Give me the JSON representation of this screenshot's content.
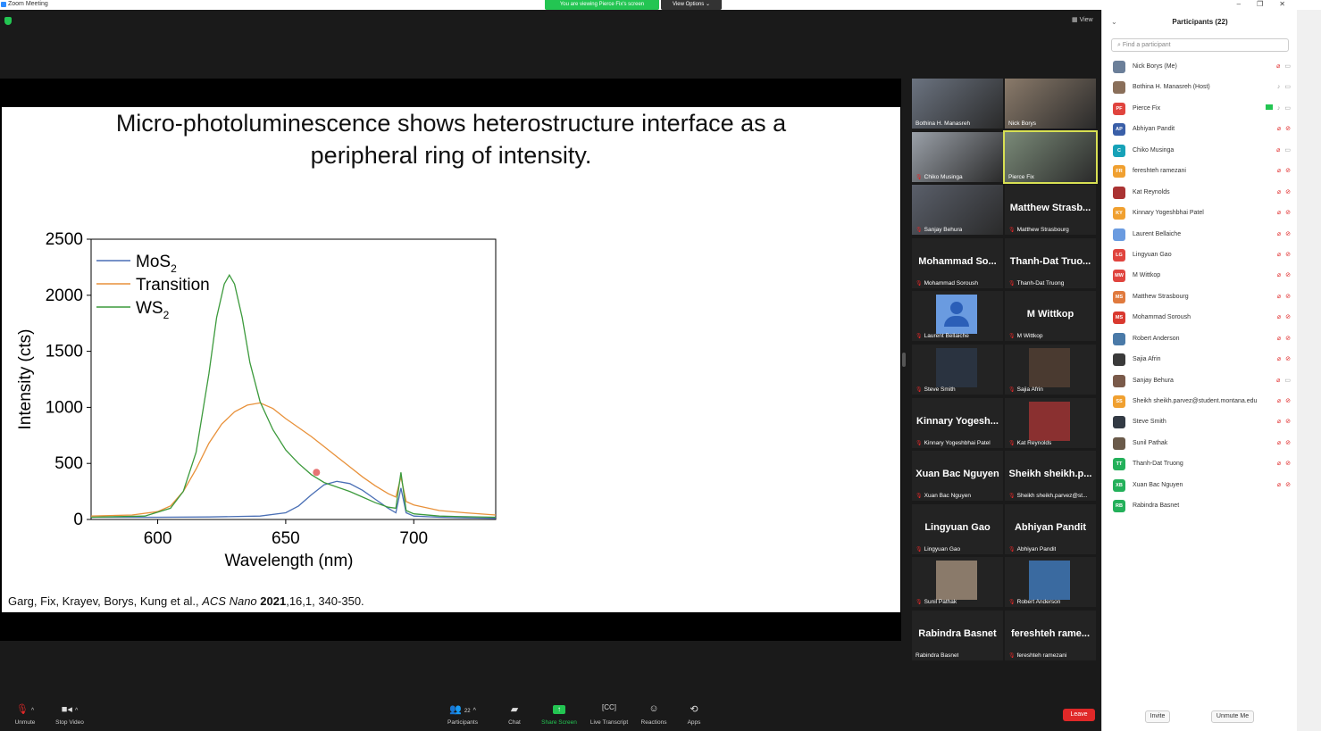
{
  "window": {
    "title": "Zoom Meeting"
  },
  "banner": {
    "viewing": "You are viewing Pierce Fix's screen",
    "view_options": "View Options ⌄"
  },
  "view_button": "View",
  "slide": {
    "title_line1": "Micro-photoluminescence shows heterostructure interface as a",
    "title_line2": "peripheral ring of intensity.",
    "citation_authors": "Garg, Fix, Krayev, Borys, Kung et al., ",
    "citation_journal": "ACS Nano",
    "citation_year": "2021",
    "citation_rest": ",16,1, 340-350."
  },
  "chart_data": {
    "type": "line",
    "xlabel": "Wavelength (nm)",
    "ylabel": "Intensity (cts)",
    "xlim": [
      574,
      732
    ],
    "ylim": [
      0,
      2500
    ],
    "xticks": [
      600,
      650,
      700
    ],
    "yticks": [
      0,
      500,
      1000,
      1500,
      2000,
      2500
    ],
    "legend_position": "top-left",
    "legend": [
      {
        "label": "MoS",
        "sub": "2",
        "color": "#4a6fb5"
      },
      {
        "label": "Transition",
        "sub": "",
        "color": "#e8913a"
      },
      {
        "label": "WS",
        "sub": "2",
        "color": "#3c9a3c"
      }
    ],
    "series": [
      {
        "name": "MoS2",
        "color": "#4a6fb5",
        "x": [
          574,
          600,
          620,
          640,
          650,
          655,
          660,
          665,
          670,
          675,
          680,
          685,
          690,
          693,
          695,
          697,
          700,
          710,
          720,
          732
        ],
        "y": [
          20,
          20,
          22,
          30,
          60,
          120,
          220,
          310,
          340,
          320,
          260,
          180,
          100,
          60,
          280,
          60,
          30,
          20,
          15,
          10
        ]
      },
      {
        "name": "Transition",
        "color": "#e8913a",
        "x": [
          574,
          590,
          600,
          605,
          610,
          615,
          620,
          625,
          630,
          635,
          640,
          645,
          650,
          655,
          660,
          665,
          670,
          675,
          680,
          685,
          690,
          693,
          695,
          697,
          700,
          710,
          720,
          732
        ],
        "y": [
          30,
          40,
          70,
          120,
          250,
          450,
          680,
          850,
          960,
          1020,
          1040,
          990,
          900,
          820,
          740,
          650,
          560,
          470,
          380,
          300,
          230,
          200,
          380,
          160,
          130,
          80,
          60,
          40
        ]
      },
      {
        "name": "WS2",
        "color": "#3c9a3c",
        "x": [
          574,
          595,
          605,
          610,
          615,
          620,
          623,
          626,
          628,
          630,
          633,
          636,
          640,
          645,
          650,
          655,
          660,
          665,
          670,
          675,
          680,
          685,
          690,
          693,
          695,
          697,
          700,
          710,
          720,
          732
        ],
        "y": [
          20,
          30,
          100,
          250,
          600,
          1300,
          1800,
          2100,
          2180,
          2100,
          1800,
          1400,
          1050,
          800,
          620,
          500,
          400,
          330,
          290,
          250,
          200,
          150,
          110,
          100,
          420,
          80,
          50,
          30,
          25,
          20
        ]
      }
    ]
  },
  "gallery": [
    {
      "name": "Bothina H. Manasreh",
      "big": "",
      "video": "room",
      "muted": false
    },
    {
      "name": "Nick Borys",
      "big": "",
      "video": "person",
      "muted": false
    },
    {
      "name": "Chiko Musinga",
      "big": "",
      "video": "window",
      "muted": true
    },
    {
      "name": "Pierce Fix",
      "big": "",
      "video": "person2",
      "muted": false,
      "active": true
    },
    {
      "name": "Sanjay Behura",
      "big": "",
      "video": "person3",
      "muted": true
    },
    {
      "name": "Matthew Strasbourg",
      "big": "Matthew  Strasb...",
      "video": "",
      "muted": true
    },
    {
      "name": "Mohammad Soroush",
      "big": "Mohammad  So...",
      "video": "",
      "muted": true
    },
    {
      "name": "Thanh-Dat Truong",
      "big": "Thanh-Dat  Truo...",
      "video": "",
      "muted": true
    },
    {
      "name": "Laurent Bellaiche",
      "big": "",
      "video": "avatar-blue",
      "muted": true
    },
    {
      "name": "M Wittkop",
      "big": "M Wittkop",
      "video": "",
      "muted": true
    },
    {
      "name": "Steve Smith",
      "big": "",
      "video": "pic-dark",
      "muted": true
    },
    {
      "name": "Sajia Afrin",
      "big": "",
      "video": "pic-face",
      "muted": true
    },
    {
      "name": "Kinnary Yogeshbhai Patel",
      "big": "Kinnary  Yogesh...",
      "video": "",
      "muted": true
    },
    {
      "name": "Kat Reynolds",
      "big": "",
      "video": "pic-red",
      "muted": true
    },
    {
      "name": "Xuan Bac Nguyen",
      "big": "Xuan Bac Nguyen",
      "video": "",
      "muted": true
    },
    {
      "name": "Sheikh sheikh.parvez@st...",
      "big": "Sheikh  sheikh.p...",
      "video": "",
      "muted": true
    },
    {
      "name": "Lingyuan Gao",
      "big": "Lingyuan Gao",
      "video": "",
      "muted": true
    },
    {
      "name": "Abhiyan Pandit",
      "big": "Abhiyan Pandit",
      "video": "",
      "muted": true
    },
    {
      "name": "Sunil Pathak",
      "big": "",
      "video": "pic-man",
      "muted": true
    },
    {
      "name": "Robert Anderson",
      "big": "",
      "video": "pic-statue",
      "muted": true
    },
    {
      "name": "Rabindra Basnet",
      "big": "Rabindra Basnet",
      "video": "",
      "muted": false
    },
    {
      "name": "fereshteh ramezani",
      "big": "fereshteh  rame...",
      "video": "",
      "muted": true
    }
  ],
  "toolbar": {
    "unmute": "Unmute",
    "stop_video": "Stop Video",
    "participants": "Participants",
    "participants_count": "22",
    "chat": "Chat",
    "share_screen": "Share Screen",
    "live_transcript": "Live Transcript",
    "reactions": "Reactions",
    "apps": "Apps",
    "leave": "Leave"
  },
  "panel": {
    "header": "Participants (22)",
    "search_placeholder": "Find a participant",
    "invite": "Invite",
    "unmute_me": "Unmute Me",
    "participants": [
      {
        "name": "Nick Borys (Me)",
        "initials": "",
        "color": "#6b7f99",
        "muted": true,
        "video_off": false
      },
      {
        "name": "Bothina H. Manasreh (Host)",
        "initials": "",
        "color": "#8a6f5a",
        "muted": false,
        "video_off": false
      },
      {
        "name": "Pierce Fix",
        "initials": "PF",
        "color": "#e0443e",
        "muted": false,
        "video_off": false,
        "sharing": true
      },
      {
        "name": "Abhiyan Pandit",
        "initials": "AP",
        "color": "#3a5fa8",
        "muted": true,
        "video_off": true
      },
      {
        "name": "Chiko Musinga",
        "initials": "C",
        "color": "#17a2b8",
        "muted": true,
        "video_off": false
      },
      {
        "name": "fereshteh ramezani",
        "initials": "FR",
        "color": "#f0a030",
        "muted": true,
        "video_off": true
      },
      {
        "name": "Kat Reynolds",
        "initials": "",
        "color": "#a33",
        "muted": true,
        "video_off": true
      },
      {
        "name": "Kinnary Yogeshbhai Patel",
        "initials": "KY",
        "color": "#f0a030",
        "muted": true,
        "video_off": true
      },
      {
        "name": "Laurent Bellaiche",
        "initials": "",
        "color": "#6a9be0",
        "muted": true,
        "video_off": true
      },
      {
        "name": "Lingyuan Gao",
        "initials": "LG",
        "color": "#e0443e",
        "muted": true,
        "video_off": true
      },
      {
        "name": "M Wittkop",
        "initials": "MW",
        "color": "#e0443e",
        "muted": true,
        "video_off": true
      },
      {
        "name": "Matthew Strasbourg",
        "initials": "MS",
        "color": "#e07a3e",
        "muted": true,
        "video_off": true
      },
      {
        "name": "Mohammad Soroush",
        "initials": "MS",
        "color": "#d9392f",
        "muted": true,
        "video_off": true
      },
      {
        "name": "Robert Anderson",
        "initials": "",
        "color": "#4a7aa8",
        "muted": true,
        "video_off": true
      },
      {
        "name": "Sajia Afrin",
        "initials": "",
        "color": "#3a3a3a",
        "muted": true,
        "video_off": true
      },
      {
        "name": "Sanjay Behura",
        "initials": "",
        "color": "#7a5a4a",
        "muted": true,
        "video_off": false
      },
      {
        "name": "Sheikh sheikh.parvez@student.montana.edu",
        "initials": "SS",
        "color": "#f0a030",
        "muted": true,
        "video_off": true
      },
      {
        "name": "Steve Smith",
        "initials": "",
        "color": "#333a44",
        "muted": true,
        "video_off": true
      },
      {
        "name": "Sunil Pathak",
        "initials": "",
        "color": "#6a5a4a",
        "muted": true,
        "video_off": true
      },
      {
        "name": "Thanh-Dat Truong",
        "initials": "TT",
        "color": "#23b05a",
        "muted": true,
        "video_off": true
      },
      {
        "name": "Xuan Bac Nguyen",
        "initials": "XB",
        "color": "#23b05a",
        "muted": true,
        "video_off": true
      },
      {
        "name": "Rabindra Basnet",
        "initials": "RB",
        "color": "#23b05a",
        "muted": false,
        "video_off": false,
        "no_icons": true
      }
    ]
  }
}
